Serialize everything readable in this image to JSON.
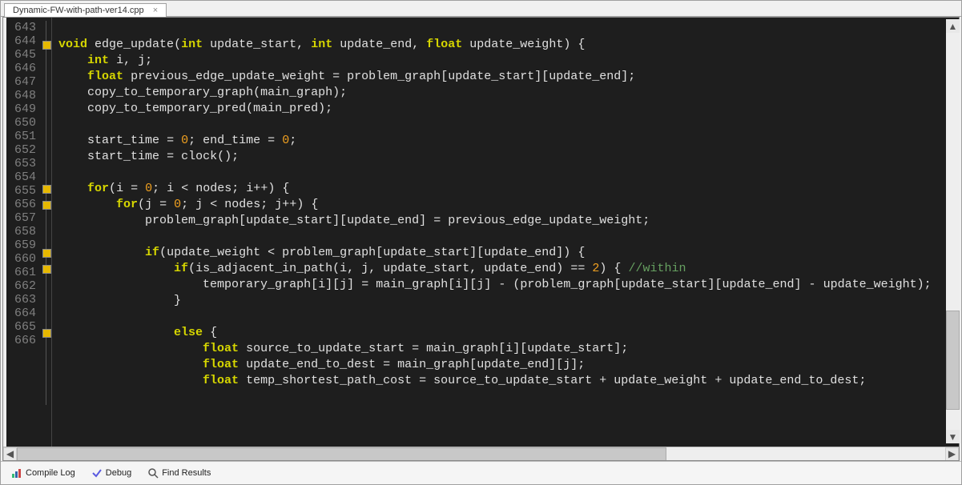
{
  "tab": {
    "filename": "Dynamic-FW-with-path-ver14.cpp"
  },
  "gutter": {
    "lines": [
      643,
      644,
      645,
      646,
      647,
      648,
      649,
      650,
      651,
      652,
      653,
      654,
      655,
      656,
      657,
      658,
      659,
      660,
      661,
      662,
      663,
      664,
      665,
      666
    ],
    "fold_markers": [
      644,
      653,
      654,
      657,
      658,
      662
    ]
  },
  "code_lines": [
    {
      "n": 643,
      "t": ""
    },
    {
      "n": 644,
      "t": "void edge_update(int update_start, int update_end, float update_weight) {"
    },
    {
      "n": 645,
      "t": "    int i, j;"
    },
    {
      "n": 646,
      "t": "    float previous_edge_update_weight = problem_graph[update_start][update_end];"
    },
    {
      "n": 647,
      "t": "    copy_to_temporary_graph(main_graph);"
    },
    {
      "n": 648,
      "t": "    copy_to_temporary_pred(main_pred);"
    },
    {
      "n": 649,
      "t": ""
    },
    {
      "n": 650,
      "t": "    start_time = 0; end_time = 0;"
    },
    {
      "n": 651,
      "t": "    start_time = clock();"
    },
    {
      "n": 652,
      "t": ""
    },
    {
      "n": 653,
      "t": "    for(i = 0; i < nodes; i++) {"
    },
    {
      "n": 654,
      "t": "        for(j = 0; j < nodes; j++) {"
    },
    {
      "n": 655,
      "t": "            problem_graph[update_start][update_end] = previous_edge_update_weight;"
    },
    {
      "n": 656,
      "t": ""
    },
    {
      "n": 657,
      "t": "            if(update_weight < problem_graph[update_start][update_end]) {"
    },
    {
      "n": 658,
      "t": "                if(is_adjacent_in_path(i, j, update_start, update_end) == 2) { //within"
    },
    {
      "n": 659,
      "t": "                    temporary_graph[i][j] = main_graph[i][j] - (problem_graph[update_start][update_end] - update_weight);"
    },
    {
      "n": 660,
      "t": "                }"
    },
    {
      "n": 661,
      "t": ""
    },
    {
      "n": 662,
      "t": "                else {"
    },
    {
      "n": 663,
      "t": "                    float source_to_update_start = main_graph[i][update_start];"
    },
    {
      "n": 664,
      "t": "                    float update_end_to_dest = main_graph[update_end][j];"
    },
    {
      "n": 665,
      "t": "                    float temp_shortest_path_cost = source_to_update_start + update_weight + update_end_to_dest;"
    },
    {
      "n": 666,
      "t": ""
    }
  ],
  "bottom_tabs": {
    "compile_log": "Compile Log",
    "debug": "Debug",
    "find": "Find Results"
  }
}
